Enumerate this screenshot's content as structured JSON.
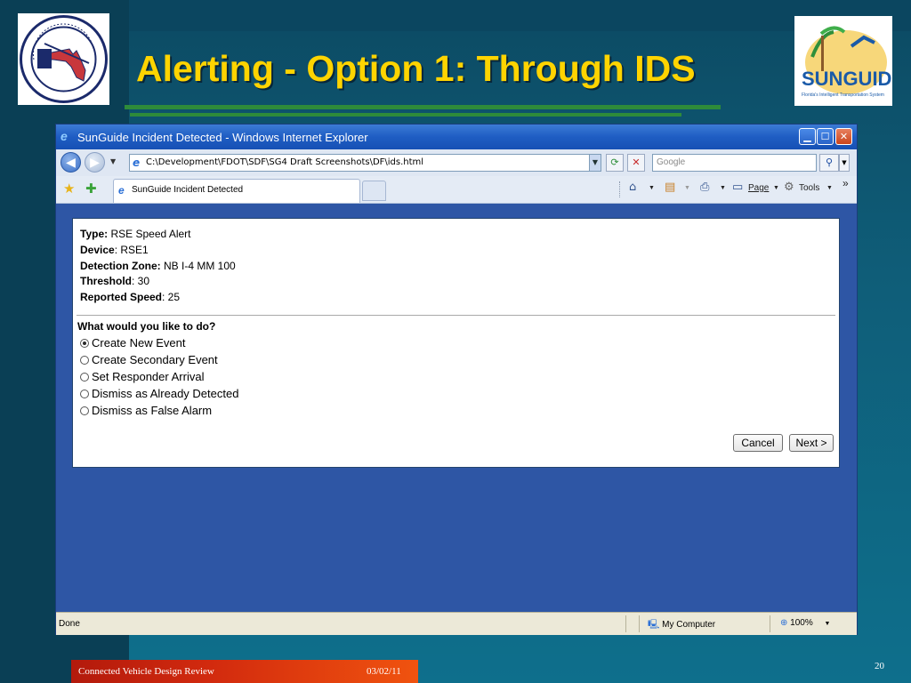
{
  "slide": {
    "title": "Alerting - Option 1: Through IDS",
    "footer_text": "Connected Vehicle Design Review",
    "footer_date": "03/02/11",
    "slide_number": "20",
    "logo_left": {
      "icon": "fdot-seal",
      "text_ring": "STATE OF FLORIDA • DEPARTMENT OF TRANSPORTATION"
    },
    "logo_right": {
      "icon": "sunguide-logo",
      "wordmark": "SUNGUIDE",
      "tagline": "Florida's Intelligent Transportation System"
    }
  },
  "browser": {
    "window_title": "SunGuide Incident Detected - Windows Internet Explorer",
    "address_url": "C:\\Development\\FDOT\\SDF\\SG4 Draft Screenshots\\DF\\ids.html",
    "search_placeholder": "Google",
    "tab_label": "SunGuide Incident Detected",
    "commands": {
      "page": "Page",
      "tools": "Tools"
    },
    "status": {
      "text": "Done",
      "zone": "My Computer",
      "zoom": "100%"
    }
  },
  "alert": {
    "type_label": "Type:",
    "type_value": " RSE Speed Alert",
    "device_label": "Device",
    "device_value": ": RSE1",
    "zone_label": "Detection Zone:",
    "zone_value": " NB I-4 MM 100",
    "threshold_label": "Threshold",
    "threshold_value": ": 30",
    "speed_label": "Reported Speed",
    "speed_value": ": 25",
    "question": "What would you like to do?",
    "options": [
      {
        "label": "Create New Event",
        "checked": true
      },
      {
        "label": "Create Secondary Event",
        "checked": false
      },
      {
        "label": "Set Responder Arrival",
        "checked": false
      },
      {
        "label": "Dismiss as Already Detected",
        "checked": false
      },
      {
        "label": "Dismiss as False Alarm",
        "checked": false
      }
    ],
    "cancel_label": "Cancel",
    "next_label": "Next >"
  },
  "colors": {
    "title_yellow": "#ffd400",
    "slide_blue": "#0f5d78",
    "ie_blue": "#1f5dc3",
    "content_blue": "#2e56a5",
    "footer_red": "#d22a0e"
  }
}
